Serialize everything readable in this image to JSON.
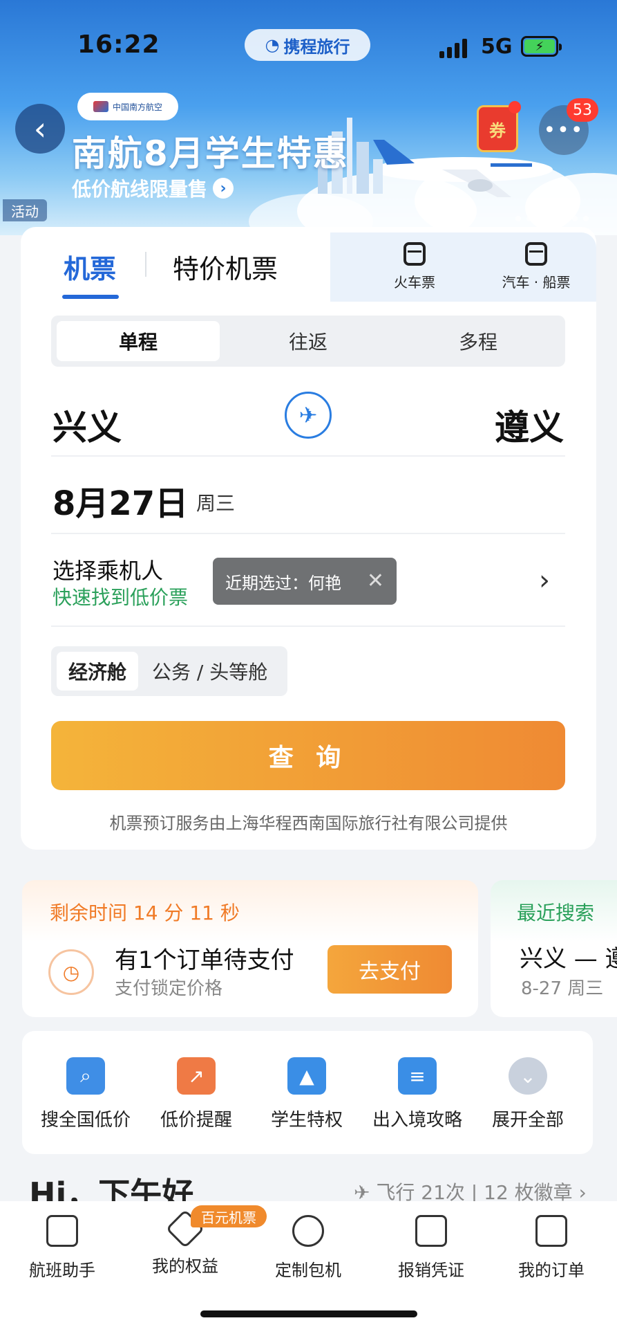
{
  "status_bar": {
    "time": "16:22",
    "app_pill": "携程旅行",
    "network": "5G"
  },
  "banner": {
    "airline_logo_text": "中国南方航空",
    "title": "南航8月学生特惠",
    "subtitle": "低价航线限量售",
    "activity_tag": "活动",
    "coupon_label": "券",
    "notification_count": "53"
  },
  "tabs": {
    "flight": "机票",
    "special": "特价机票",
    "train": "火车票",
    "bus_ship": "汽车 · 船票"
  },
  "trip_types": [
    "单程",
    "往返",
    "多程"
  ],
  "route": {
    "from": "兴义",
    "to": "遵义"
  },
  "date": {
    "day": "8月27日",
    "weekday": "周三"
  },
  "passenger": {
    "title": "选择乘机人",
    "subtitle": "快速找到低价票",
    "tooltip": "近期选过：何艳"
  },
  "cabin": {
    "economy": "经济舱",
    "business": "公务 / 头等舱"
  },
  "search_button": "查 询",
  "provider_note": "机票预订服务由上海华程西南国际旅行社有限公司提供",
  "pending_order": {
    "timer": "剩余时间 14 分 11 秒",
    "title": "有1个订单待支付",
    "subtitle": "支付锁定价格",
    "pay_button": "去支付"
  },
  "recent_search": {
    "title": "最近搜索",
    "route": "兴义 — 遵",
    "date": "8-27 周三"
  },
  "shortcuts": [
    "搜全国低价",
    "低价提醒",
    "学生特权",
    "出入境攻略",
    "展开全部"
  ],
  "greeting": "Hi，下午好",
  "stats": "飞行 21次 | 12 枚徽章 ›",
  "bottom_tabs": [
    "航班助手",
    "我的权益",
    "定制包机",
    "报销凭证",
    "我的订单"
  ],
  "bottom_badge": "百元机票",
  "colors": {
    "primary": "#2468d8",
    "accent_orange": "#ef8a33",
    "green": "#2aa05a"
  }
}
